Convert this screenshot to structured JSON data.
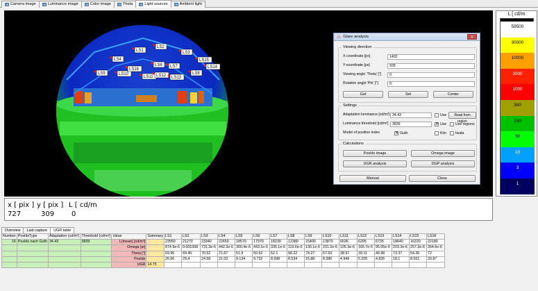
{
  "top_tabs": [
    {
      "label": "Camera image"
    },
    {
      "label": "Luminance image"
    },
    {
      "label": "Color image"
    },
    {
      "label": "Theta"
    },
    {
      "label": "Light sources",
      "active": true
    },
    {
      "label": "Ambient light"
    }
  ],
  "light_sources": [
    "LS1",
    "LS2",
    "LS3",
    "LS4",
    "LS5",
    "LS6",
    "LS7",
    "LS8",
    "LS9",
    "LS10",
    "LS11",
    "LS12",
    "LS13",
    "LS14",
    "LS15",
    "LS16"
  ],
  "dialog": {
    "title": "Glare analysis",
    "viewing_direction": {
      "group": "Viewing direction",
      "x_label": "X-coordinate [px]",
      "x_value": "1402",
      "y_label": "Y-coordinate [px]",
      "y_value": "928",
      "theta_label": "Viewing angle 'Theta' [°]",
      "theta_value": "0",
      "phi_label": "Rotation angle 'Phi' [°]",
      "phi_value": "0",
      "get": "Get",
      "set": "Set",
      "center": "Center"
    },
    "settings": {
      "group": "Settings",
      "adapt_label": "Adaptation luminance [cd/m²]",
      "adapt_value": "34.43",
      "use": "Use",
      "read_regions": "Read from region",
      "threshold_label": "Luminance threshold [cd/m²]",
      "threshold_value": "3839",
      "use2": "Use",
      "use_regions": "Use regions",
      "model_label": "Model of position index",
      "guth": "Guth",
      "kim": "Kim",
      "iwata": "Iwata"
    },
    "calculations": {
      "group": "Calculations",
      "posidx": "PosIdx image",
      "omega": "Omega image",
      "ugr": "UGR analysis",
      "dgp": "DGP analysis"
    },
    "manual": "Manual",
    "close": "Close"
  },
  "scale": {
    "title": "L [ cd/m",
    "ticks": [
      "59500",
      "30000",
      "10000",
      "3000",
      "1000",
      "300",
      "100",
      "30",
      "10",
      "3",
      "1"
    ],
    "colors": {
      "t0": "#ffffff",
      "t1": "#ffff00",
      "t2": "#ffa000",
      "t3": "#ff2000",
      "t4": "#ff0000",
      "t5": "#a0a000",
      "t6": "#00c000",
      "t7": "#00ff00",
      "t8": "#00a0ff",
      "t9": "#0000ff",
      "t10": "#000060"
    }
  },
  "readout": {
    "x_label": "x [ pix ]",
    "y_label": "y [ pix ]",
    "l_label": "L [ cd/m",
    "x": "727",
    "y": "309",
    "l": "0"
  },
  "bottom_tabs": [
    "Overview",
    "Last capture",
    "UGR table"
  ],
  "table": {
    "headers": [
      "Number",
      "PosIdxType",
      "Adaptation (cd/m²)",
      "Threshold (cd/m²)",
      "Value",
      "Summary",
      "LS1",
      "LS2",
      "LS3",
      "LS4",
      "LS5",
      "LS6",
      "LS7",
      "LS8",
      "LS9",
      "LS10",
      "LS11",
      "LS12",
      "LS13",
      "LS14",
      "LS15",
      "LS16"
    ],
    "meta": [
      "16",
      "PosIdx nach Guth",
      "34.43",
      "3839"
    ],
    "rows": [
      {
        "label": "L(mean) [cd/m²]",
        "summary": "",
        "vals": [
          "23950",
          "21270",
          "23340",
          "22650",
          "18570",
          "17970",
          "18230",
          "12380",
          "15400",
          "13870",
          "6636",
          "6295",
          "6735",
          "18640",
          "16220",
          "22180"
        ]
      },
      {
        "label": "Omega [sr]",
        "summary": "",
        "vals": [
          "874.9e-6",
          "0.001008",
          "731.3e-6",
          "442.3e-6",
          "360.4e-6",
          "443.1e-6",
          "335.1e-6",
          "119.6e-6",
          "130.1e-6",
          "201.2e-6",
          "105.3e-6",
          "165.7e-6",
          "95.05e-6",
          "203.3e-6",
          "257.3e-6",
          "354.6e-6"
        ]
      },
      {
        "label": "Theta [°]",
        "summary": "",
        "vals": [
          "69.96",
          "69.45",
          "70.52",
          "71.67",
          "51.9",
          "50.92",
          "52.1",
          "58.22",
          "74.27",
          "57.63",
          "38.97",
          "39.11",
          "40.98",
          "73.37",
          "54.36",
          "72"
        ]
      },
      {
        "label": "PosIdx",
        "summary": "",
        "vals": [
          "26.66",
          "29.4",
          "24.58",
          "21.03",
          "9.134",
          "9.732",
          "8.998",
          "8.534",
          "15.88",
          "8.386",
          "4.949",
          "5.205",
          "4.826",
          "18.1",
          "8.561",
          "20.87"
        ]
      },
      {
        "label": "UGR",
        "summary": "14.75",
        "vals": [
          "",
          "",
          "",
          "",
          "",
          "",
          "",
          "",
          "",
          "",
          "",
          "",
          "",
          "",
          "",
          ""
        ]
      }
    ]
  }
}
